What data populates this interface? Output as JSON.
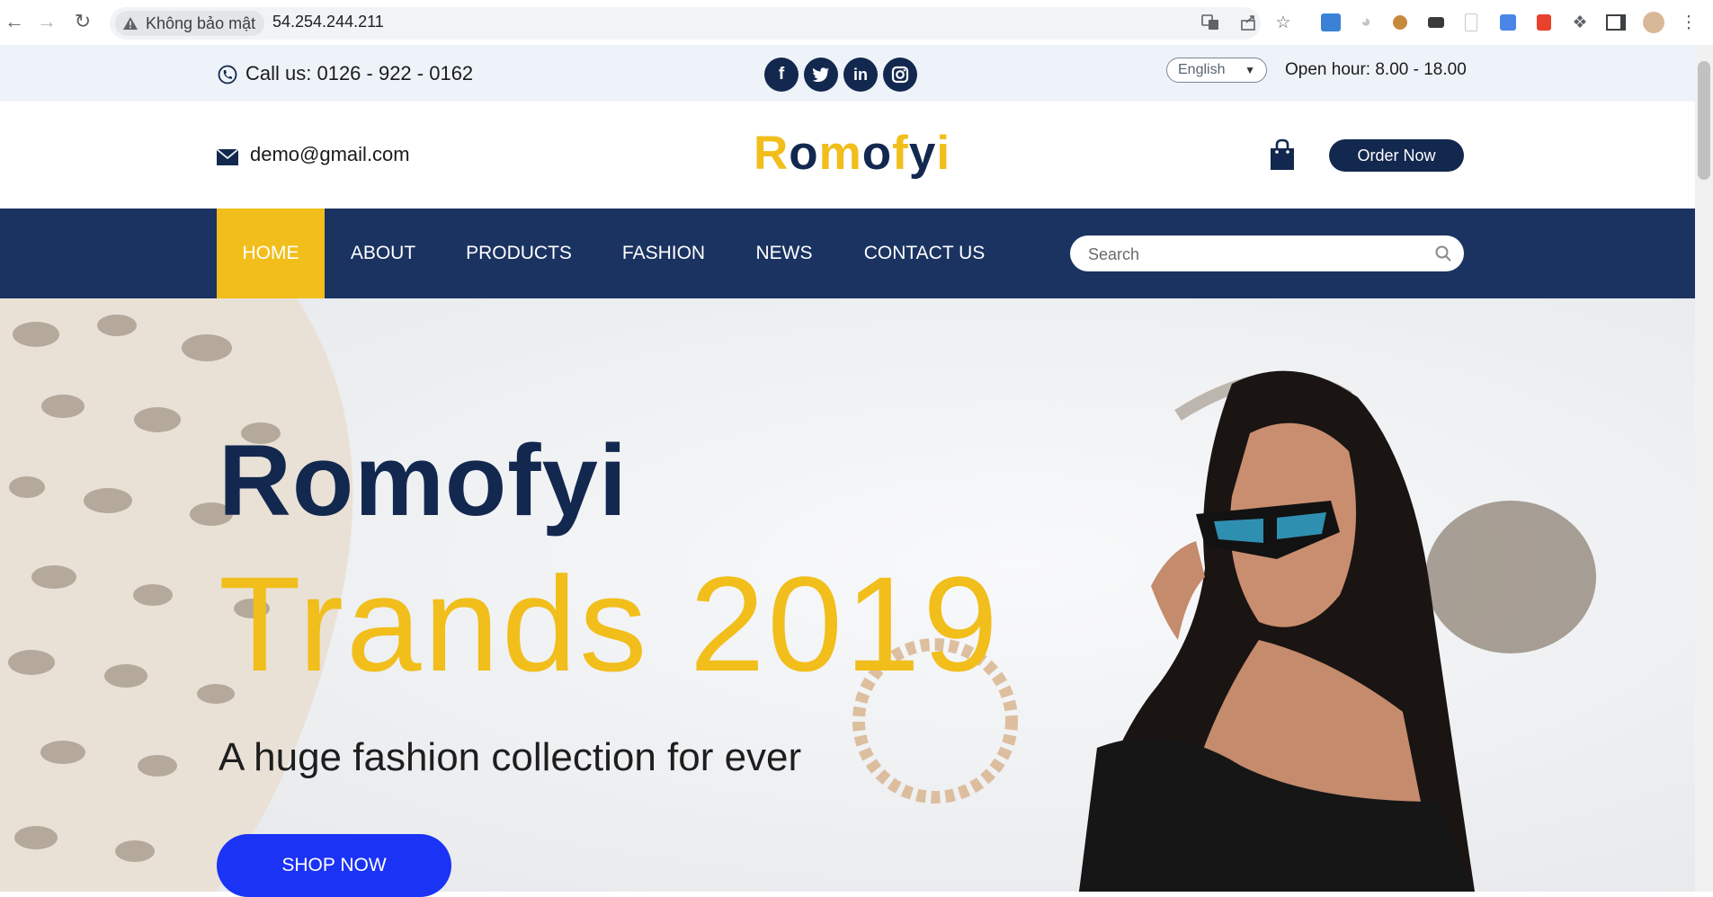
{
  "browser": {
    "security_label": "Không bảo mật",
    "url": "54.254.244.211",
    "icons": [
      "back-arrow-icon",
      "forward-arrow-icon",
      "reload-icon",
      "warning-icon",
      "translate-icon",
      "share-icon",
      "star-icon",
      "extension-icons",
      "puzzle-icon",
      "sidebar-icon",
      "profile-avatar",
      "menu-dots-icon"
    ]
  },
  "topbar": {
    "phone": "Call us: 0126 - 922 - 0162",
    "social": [
      "facebook-icon",
      "twitter-icon",
      "linkedin-icon",
      "instagram-icon"
    ],
    "language": "English",
    "open_hour": "Open hour: 8.00 - 18.00"
  },
  "header": {
    "email": "demo@gmail.com",
    "logo": "Romofyi",
    "order_button": "Order Now"
  },
  "nav": {
    "items": [
      {
        "label": "HOME",
        "active": true
      },
      {
        "label": "ABOUT",
        "active": false
      },
      {
        "label": "PRODUCTS",
        "active": false
      },
      {
        "label": "FASHION",
        "active": false
      },
      {
        "label": "NEWS",
        "active": false
      },
      {
        "label": "CONTACT US",
        "active": false
      }
    ],
    "search_placeholder": "Search"
  },
  "hero": {
    "title": "Romofyi",
    "subtitle": "Trands 2019",
    "tagline": "A huge fashion collection for ever",
    "button": "SHOP NOW"
  },
  "colors": {
    "navy": "#13284f",
    "nav_bg": "#1a3361",
    "yellow": "#f1be1b",
    "blue_button": "#1b33f5",
    "topbar_bg": "#eef3f9"
  }
}
